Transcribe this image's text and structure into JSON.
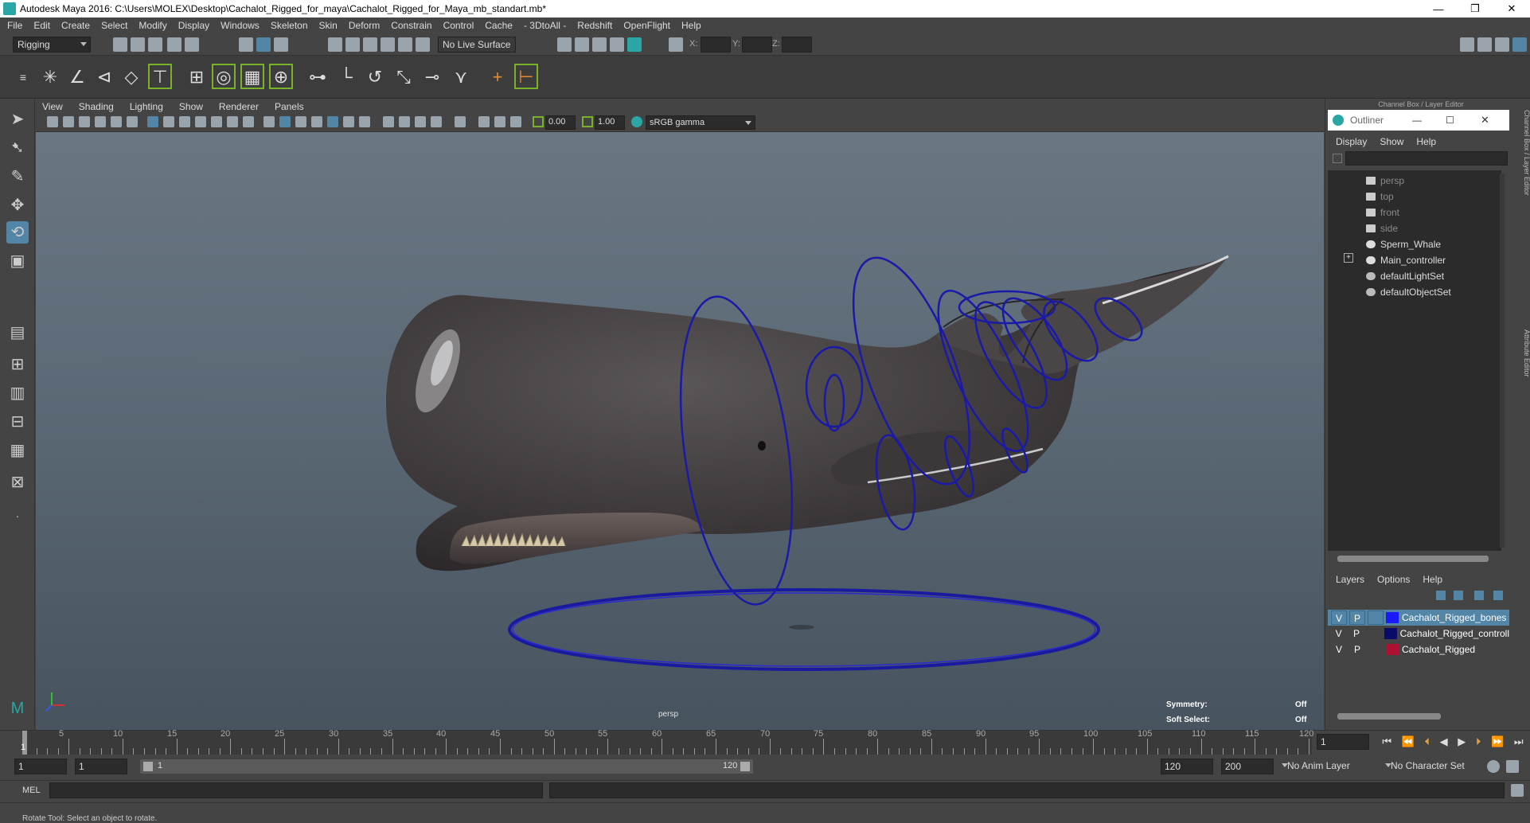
{
  "window": {
    "title": "Autodesk Maya 2016: C:\\Users\\MOLEX\\Desktop\\Cachalot_Rigged_for_maya\\Cachalot_Rigged_for_Maya_mb_standart.mb*",
    "min": "—",
    "restore": "❐",
    "close": "✕"
  },
  "menu": [
    "File",
    "Edit",
    "Create",
    "Select",
    "Modify",
    "Display",
    "Windows",
    "Skeleton",
    "Skin",
    "Deform",
    "Constrain",
    "Control",
    "Cache",
    "- 3DtoAll -",
    "Redshift",
    "OpenFlight",
    "Help"
  ],
  "statusline": {
    "mode": "Rigging",
    "live_surface": "No Live Surface",
    "x_label": "X:",
    "y_label": "Y:",
    "z_label": "Z:"
  },
  "panel_menu": [
    "View",
    "Shading",
    "Lighting",
    "Show",
    "Renderer",
    "Panels"
  ],
  "panel_toolbar": {
    "exposure": "0.00",
    "gamma": "1.00",
    "color_space": "sRGB gamma"
  },
  "viewport": {
    "camera": "persp",
    "symmetry_label": "Symmetry:",
    "symmetry_value": "Off",
    "soft_select_label": "Soft Select:",
    "soft_select_value": "Off"
  },
  "right_panel": {
    "header": "Channel Box / Layer Editor",
    "side_tabs": [
      "Channel Box / Layer Editor",
      "Attribute Editor"
    ]
  },
  "outliner": {
    "title": "Outliner",
    "menu": [
      "Display",
      "Show",
      "Help"
    ],
    "items": [
      {
        "name": "persp",
        "dim": true,
        "icon": "camera-icon"
      },
      {
        "name": "top",
        "dim": true,
        "icon": "camera-icon"
      },
      {
        "name": "front",
        "dim": true,
        "icon": "camera-icon"
      },
      {
        "name": "side",
        "dim": true,
        "icon": "camera-icon"
      },
      {
        "name": "Sperm_Whale",
        "dim": false,
        "icon": "transform-icon"
      },
      {
        "name": "Main_controller",
        "dim": false,
        "icon": "transform-icon",
        "expandable": true
      },
      {
        "name": "defaultLightSet",
        "dim": false,
        "icon": "set-icon"
      },
      {
        "name": "defaultObjectSet",
        "dim": false,
        "icon": "set-icon"
      }
    ]
  },
  "layers": {
    "menu": [
      "Layers",
      "Options",
      "Help"
    ],
    "rows": [
      {
        "v": "V",
        "p": "P",
        "name": "Cachalot_Rigged_bones",
        "color": "#1a1aff",
        "selected": true
      },
      {
        "v": "V",
        "p": "P",
        "name": "Cachalot_Rigged_controll",
        "color": "#0a0a6a",
        "selected": false
      },
      {
        "v": "V",
        "p": "P",
        "name": "Cachalot_Rigged",
        "color": "#b01030",
        "selected": false
      }
    ]
  },
  "timeline": {
    "current_frame_marker": "1",
    "ticks": [
      "5",
      "10",
      "15",
      "20",
      "25",
      "30",
      "35",
      "40",
      "45",
      "50",
      "55",
      "60",
      "65",
      "70",
      "75",
      "80",
      "85",
      "90",
      "95",
      "100",
      "105",
      "110",
      "115",
      "120"
    ],
    "current_frame": "1",
    "start": "1",
    "playback_start": "1",
    "range_start_label": "1",
    "range_end_label": "120",
    "playback_end": "120",
    "end": "200",
    "anim_layer": "No Anim Layer",
    "character_set": "No Character Set"
  },
  "command_line": {
    "label": "MEL"
  },
  "help_line": "Rotate Tool: Select an object to rotate."
}
